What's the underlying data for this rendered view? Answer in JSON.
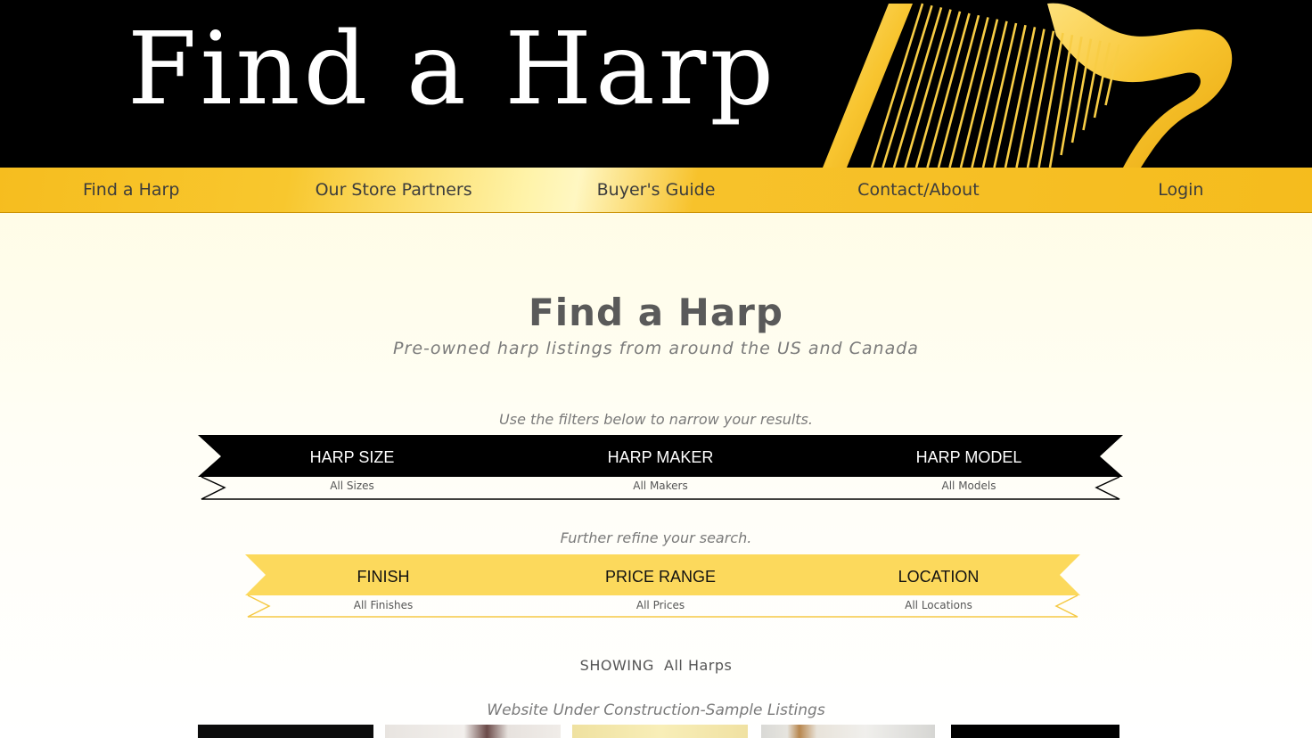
{
  "header": {
    "logo_text": "Find a Harp"
  },
  "nav": {
    "items": [
      {
        "label": "Find a Harp"
      },
      {
        "label": "Our Store Partners"
      },
      {
        "label": "Buyer's Guide"
      },
      {
        "label": "Contact/About"
      },
      {
        "label": "Login"
      }
    ]
  },
  "main": {
    "title": "Find a Harp",
    "subtitle": "Pre-owned harp listings from around the US and Canada",
    "filters_hint": "Use the filters below to narrow your results.",
    "filters": [
      {
        "label": "HARP SIZE",
        "value": "All Sizes"
      },
      {
        "label": "HARP MAKER",
        "value": "All Makers"
      },
      {
        "label": "HARP MODEL",
        "value": "All Models"
      }
    ],
    "refine_hint": "Further refine your search.",
    "refine": [
      {
        "label": "FINISH",
        "value": "All Finishes"
      },
      {
        "label": "PRICE RANGE",
        "value": "All Prices"
      },
      {
        "label": "LOCATION",
        "value": "All Locations"
      }
    ],
    "showing_label": "SHOWING",
    "showing_value": "All Harps",
    "listings_note": "Website Under Construction-Sample Listings"
  },
  "colors": {
    "header_bg": "#000000",
    "gold": "#f7c22b",
    "ribbon_gold": "#fcd95c",
    "text_gray": "#5a5a5a"
  }
}
